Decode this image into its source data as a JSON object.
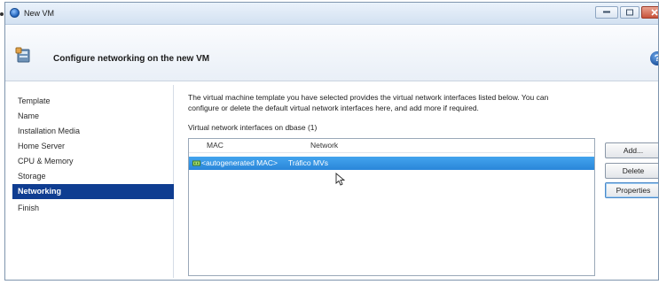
{
  "window": {
    "title": "New VM",
    "icon": "xencenter-logo-icon"
  },
  "header": {
    "title": "Configure networking on the new VM",
    "icon": "vm-wizard-icon",
    "help_icon": "help-icon"
  },
  "sidebar": {
    "items": [
      {
        "label": "Template",
        "active": false
      },
      {
        "label": "Name",
        "active": false
      },
      {
        "label": "Installation Media",
        "active": false
      },
      {
        "label": "Home Server",
        "active": false
      },
      {
        "label": "CPU & Memory",
        "active": false
      },
      {
        "label": "Storage",
        "active": false
      },
      {
        "label": "Networking",
        "active": true
      },
      {
        "label": "Finish",
        "active": false
      }
    ]
  },
  "main": {
    "description_line1": "The virtual machine template you have selected provides the virtual network interfaces listed below. You can",
    "description_line2": "configure or delete the default virtual network interfaces here, and add more if required.",
    "section_label": "Virtual network interfaces on dbase (1)",
    "list": {
      "columns": [
        "MAC",
        "Network"
      ],
      "rows": [
        {
          "mac": "<autogenerated MAC>",
          "network": "Tráfico MVs",
          "selected": true
        }
      ]
    },
    "buttons": {
      "add": "Add...",
      "delete": "Delete",
      "properties": "Properties"
    }
  },
  "colors": {
    "selection": "#2a86d9",
    "nav_active": "#0f3d91"
  }
}
